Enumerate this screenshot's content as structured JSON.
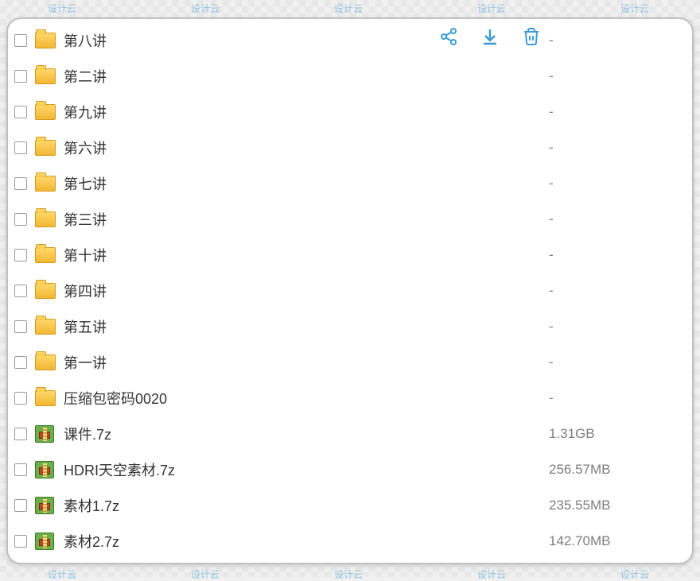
{
  "toolbar": {
    "share": "share-icon",
    "download": "download-icon",
    "delete": "delete-icon"
  },
  "watermark_text": "设计云",
  "items": [
    {
      "type": "folder",
      "name": "第八讲",
      "size": "-"
    },
    {
      "type": "folder",
      "name": "第二讲",
      "size": "-"
    },
    {
      "type": "folder",
      "name": "第九讲",
      "size": "-"
    },
    {
      "type": "folder",
      "name": "第六讲",
      "size": "-"
    },
    {
      "type": "folder",
      "name": "第七讲",
      "size": "-"
    },
    {
      "type": "folder",
      "name": "第三讲",
      "size": "-"
    },
    {
      "type": "folder",
      "name": "第十讲",
      "size": "-"
    },
    {
      "type": "folder",
      "name": "第四讲",
      "size": "-"
    },
    {
      "type": "folder",
      "name": "第五讲",
      "size": "-"
    },
    {
      "type": "folder",
      "name": "第一讲",
      "size": "-"
    },
    {
      "type": "folder",
      "name": "压缩包密码0020",
      "size": "-"
    },
    {
      "type": "archive",
      "name": "课件.7z",
      "size": "1.31GB"
    },
    {
      "type": "archive",
      "name": "HDRI天空素材.7z",
      "size": "256.57MB"
    },
    {
      "type": "archive",
      "name": "素材1.7z",
      "size": "235.55MB"
    },
    {
      "type": "archive",
      "name": "素材2.7z",
      "size": "142.70MB"
    }
  ]
}
